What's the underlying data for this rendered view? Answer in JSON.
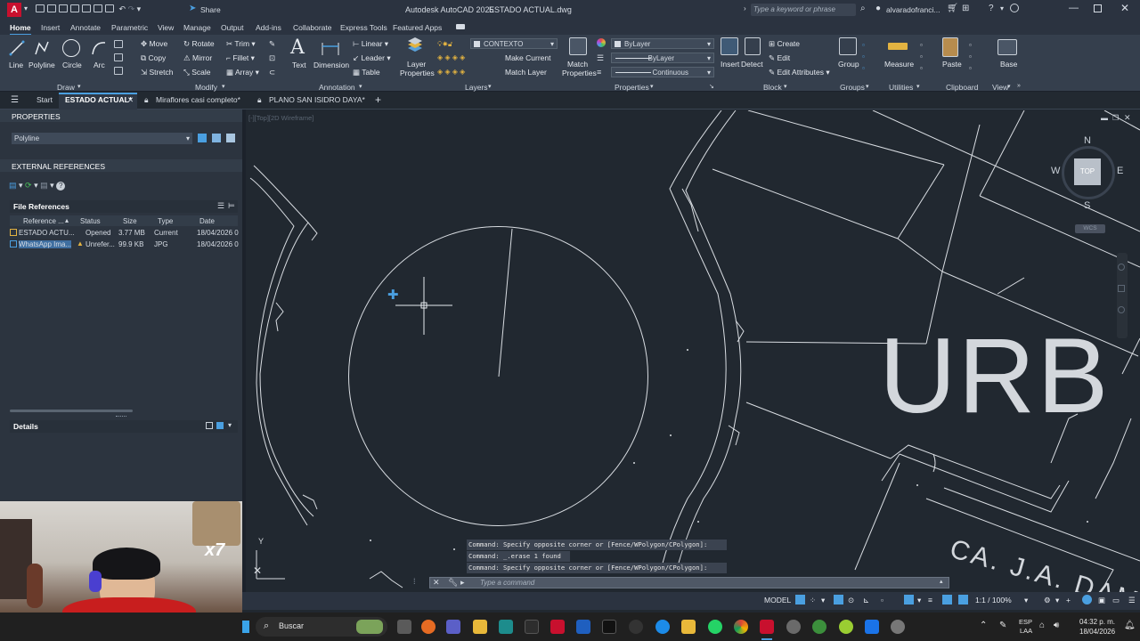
{
  "title_bar": {
    "app_title": "Autodesk AutoCAD 2025",
    "document_title": "ESTADO ACTUAL.dwg",
    "share_label": "Share",
    "search_placeholder": "Type a keyword or phrase",
    "user_name": "alvaradofranci..."
  },
  "ribbon_tabs": [
    "Home",
    "Insert",
    "Annotate",
    "Parametric",
    "View",
    "Manage",
    "Output",
    "Add-ins",
    "Collaborate",
    "Express Tools",
    "Featured Apps"
  ],
  "ribbon": {
    "draw": {
      "label": "Draw",
      "line": "Line",
      "polyline": "Polyline",
      "circle": "Circle",
      "arc": "Arc"
    },
    "modify": {
      "label": "Modify",
      "move": "Move",
      "rotate": "Rotate",
      "trim": "Trim",
      "copy": "Copy",
      "mirror": "Mirror",
      "fillet": "Fillet",
      "stretch": "Stretch",
      "scale": "Scale",
      "array": "Array"
    },
    "annotation": {
      "label": "Annotation",
      "text": "Text",
      "dimension": "Dimension",
      "linear": "Linear",
      "leader": "Leader",
      "table": "Table"
    },
    "layers": {
      "label": "Layers",
      "layer_properties_1": "Layer",
      "layer_properties_2": "Properties",
      "current_layer": "CONTEXTO",
      "make_current": "Make Current",
      "match_layer": "Match Layer"
    },
    "properties": {
      "label": "Properties",
      "match_1": "Match",
      "match_2": "Properties",
      "color": "ByLayer",
      "lineweight": "ByLayer",
      "linetype": "Continuous"
    },
    "block": {
      "label": "Block",
      "insert": "Insert",
      "detect": "Detect",
      "create": "Create",
      "edit": "Edit",
      "edit_attributes": "Edit Attributes"
    },
    "groups": {
      "label": "Groups",
      "group": "Group"
    },
    "utilities": {
      "label": "Utilities",
      "measure": "Measure"
    },
    "clipboard": {
      "label": "Clipboard",
      "paste": "Paste"
    },
    "view": {
      "label": "View",
      "base": "Base"
    }
  },
  "doc_tabs": {
    "start": "Start",
    "tabs": [
      "ESTADO ACTUAL*",
      "Miraflores casi completo*",
      "PLANO SAN ISIDRO DAYA*"
    ]
  },
  "properties_panel": {
    "header": "PROPERTIES",
    "selection": "Polyline"
  },
  "xref_panel": {
    "header": "EXTERNAL REFERENCES",
    "file_refs": "File References",
    "columns": [
      "Reference ...",
      "Status",
      "Size",
      "Type",
      "Date"
    ],
    "rows": [
      [
        "ESTADO ACTU...",
        "Opened",
        "3.77 MB",
        "Current",
        "18/04/2026 0"
      ],
      [
        "WhatsApp Ima...",
        "Unrefer...",
        "99.9 KB",
        "JPG",
        "18/04/2026 0"
      ]
    ],
    "details": "Details"
  },
  "viewport": {
    "label": "[-][Top][2D Wireframe]",
    "viewcube": {
      "n": "N",
      "s": "S",
      "e": "E",
      "w": "W",
      "top": "TOP",
      "wcs": "WCS"
    },
    "drawing_text": {
      "urb": "URB",
      "street": "CA. J.A. DAM"
    }
  },
  "command_history": [
    "Command: Specify opposite corner or [Fence/WPolygon/CPolygon]:",
    "Command: _.erase 1 found",
    "Command: Specify opposite corner or [Fence/WPolygon/CPolygon]:"
  ],
  "command_placeholder": "Type a command",
  "statusbar": {
    "model": "MODEL",
    "scale": "1:1 / 100%"
  },
  "taskbar": {
    "search": "Buscar",
    "lang_1": "ESP",
    "lang_2": "LAA",
    "time": "04:32 p. m.",
    "date": "18/04/2026"
  },
  "webcam": {
    "overlay": "x7"
  },
  "colors": {
    "accent": "#4a9fe0",
    "canvas": "#212830",
    "ribbon": "#353f4d",
    "autocad_red": "#c8102e"
  }
}
